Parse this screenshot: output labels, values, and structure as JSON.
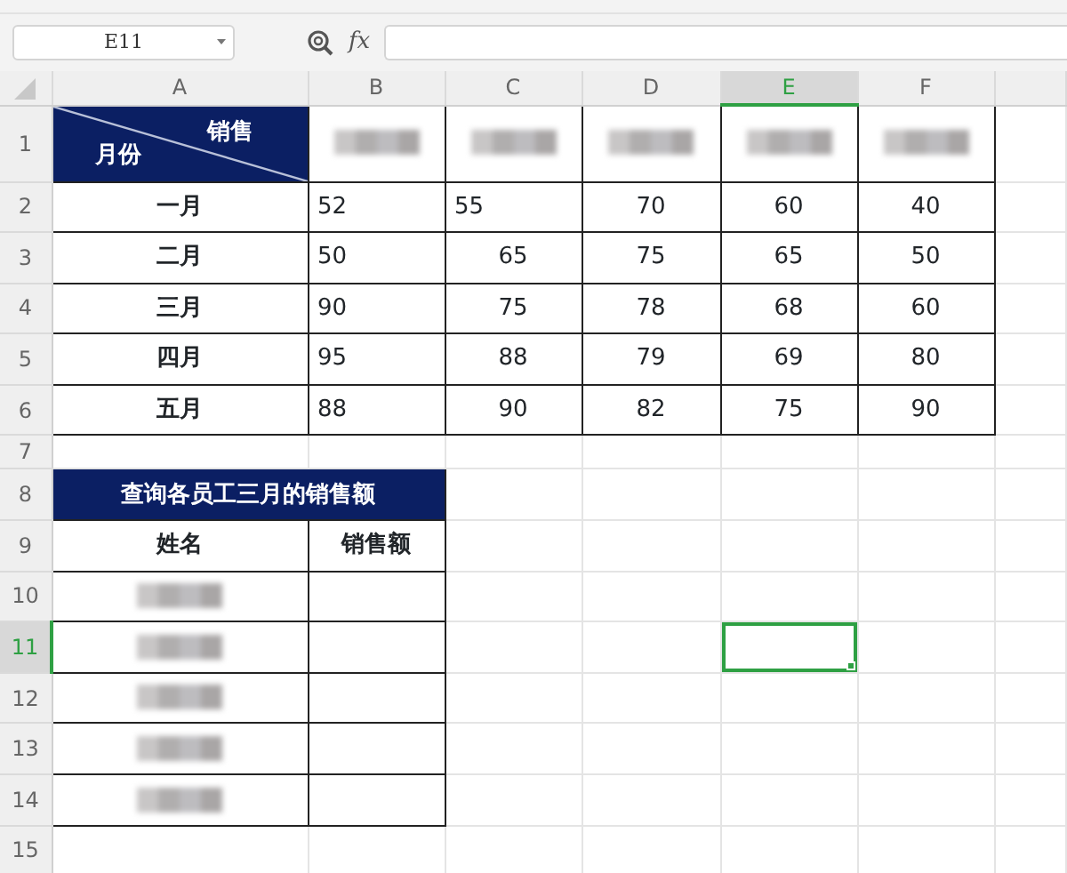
{
  "name_box": {
    "value": "E11"
  },
  "formula_bar": {
    "fx": "fx"
  },
  "columns": [
    {
      "label": "A",
      "selected": false
    },
    {
      "label": "B",
      "selected": false
    },
    {
      "label": "C",
      "selected": false
    },
    {
      "label": "D",
      "selected": false
    },
    {
      "label": "E",
      "selected": true
    },
    {
      "label": "F",
      "selected": false
    }
  ],
  "rows": [
    {
      "number": "1",
      "selected": false,
      "cells": [
        {
          "kind": "diagonal",
          "top_right": "销售",
          "bottom_left": "月份",
          "selected": false
        },
        {
          "kind": "redacted",
          "selected": false
        },
        {
          "kind": "redacted",
          "selected": false
        },
        {
          "kind": "redacted",
          "selected": false
        },
        {
          "kind": "redacted",
          "selected": false
        },
        {
          "kind": "redacted",
          "selected": false
        }
      ]
    },
    {
      "number": "2",
      "selected": false,
      "cells": [
        {
          "kind": "bold",
          "text": "一月",
          "selected": false
        },
        {
          "kind": "left",
          "text": "52",
          "selected": false
        },
        {
          "kind": "left",
          "text": "55",
          "selected": false
        },
        {
          "kind": "plain",
          "text": "70",
          "selected": false
        },
        {
          "kind": "plain",
          "text": "60",
          "selected": false
        },
        {
          "kind": "plain",
          "text": "40",
          "selected": false
        }
      ]
    },
    {
      "number": "3",
      "selected": false,
      "cells": [
        {
          "kind": "bold",
          "text": "二月",
          "selected": false
        },
        {
          "kind": "left",
          "text": "50",
          "selected": false
        },
        {
          "kind": "plain",
          "text": "65",
          "selected": false
        },
        {
          "kind": "plain",
          "text": "75",
          "selected": false
        },
        {
          "kind": "plain",
          "text": "65",
          "selected": false
        },
        {
          "kind": "plain",
          "text": "50",
          "selected": false
        }
      ]
    },
    {
      "number": "4",
      "selected": false,
      "cells": [
        {
          "kind": "bold",
          "text": "三月",
          "selected": false
        },
        {
          "kind": "left",
          "text": "90",
          "selected": false
        },
        {
          "kind": "plain",
          "text": "75",
          "selected": false
        },
        {
          "kind": "plain",
          "text": "78",
          "selected": false
        },
        {
          "kind": "plain",
          "text": "68",
          "selected": false
        },
        {
          "kind": "plain",
          "text": "60",
          "selected": false
        }
      ]
    },
    {
      "number": "5",
      "selected": false,
      "cells": [
        {
          "kind": "bold",
          "text": "四月",
          "selected": false
        },
        {
          "kind": "left",
          "text": "95",
          "selected": false
        },
        {
          "kind": "plain",
          "text": "88",
          "selected": false
        },
        {
          "kind": "plain",
          "text": "79",
          "selected": false
        },
        {
          "kind": "plain",
          "text": "69",
          "selected": false
        },
        {
          "kind": "plain",
          "text": "80",
          "selected": false
        }
      ]
    },
    {
      "number": "6",
      "selected": false,
      "cells": [
        {
          "kind": "bold",
          "text": "五月",
          "selected": false
        },
        {
          "kind": "left",
          "text": "88",
          "selected": false
        },
        {
          "kind": "plain",
          "text": "90",
          "selected": false
        },
        {
          "kind": "plain",
          "text": "82",
          "selected": false
        },
        {
          "kind": "plain",
          "text": "75",
          "selected": false
        },
        {
          "kind": "plain",
          "text": "90",
          "selected": false
        }
      ]
    },
    {
      "number": "7",
      "selected": false,
      "cells": [
        {
          "kind": "empty",
          "selected": false
        },
        {
          "kind": "empty",
          "selected": false
        },
        {
          "kind": "empty",
          "selected": false
        },
        {
          "kind": "empty",
          "selected": false
        },
        {
          "kind": "empty",
          "selected": false
        },
        {
          "kind": "empty",
          "selected": false
        }
      ]
    },
    {
      "number": "8",
      "selected": false,
      "cells": [
        {
          "kind": "title",
          "text": "查询各员工三月的销售额",
          "merged": true,
          "selected": false
        },
        {
          "kind": "empty",
          "selected": false
        },
        {
          "kind": "empty",
          "selected": false
        },
        {
          "kind": "empty",
          "selected": false
        },
        {
          "kind": "empty",
          "selected": false
        }
      ]
    },
    {
      "number": "9",
      "selected": false,
      "cells": [
        {
          "kind": "bold",
          "text": "姓名",
          "selected": false
        },
        {
          "kind": "bold",
          "text": "销售额",
          "selected": false
        },
        {
          "kind": "empty",
          "selected": false
        },
        {
          "kind": "empty",
          "selected": false
        },
        {
          "kind": "empty",
          "selected": false
        },
        {
          "kind": "empty",
          "selected": false
        }
      ]
    },
    {
      "number": "10",
      "selected": false,
      "cells": [
        {
          "kind": "redacted",
          "selected": false
        },
        {
          "kind": "blank",
          "selected": false
        },
        {
          "kind": "empty",
          "selected": false
        },
        {
          "kind": "empty",
          "selected": false
        },
        {
          "kind": "empty",
          "selected": false
        },
        {
          "kind": "empty",
          "selected": false
        }
      ]
    },
    {
      "number": "11",
      "selected": true,
      "cells": [
        {
          "kind": "redacted",
          "selected": false
        },
        {
          "kind": "blank",
          "selected": false
        },
        {
          "kind": "empty",
          "selected": false
        },
        {
          "kind": "empty",
          "selected": false
        },
        {
          "kind": "empty",
          "selected": true
        },
        {
          "kind": "empty",
          "selected": false
        }
      ]
    },
    {
      "number": "12",
      "selected": false,
      "cells": [
        {
          "kind": "redacted",
          "selected": false
        },
        {
          "kind": "blank",
          "selected": false
        },
        {
          "kind": "empty",
          "selected": false
        },
        {
          "kind": "empty",
          "selected": false
        },
        {
          "kind": "empty",
          "selected": false
        },
        {
          "kind": "empty",
          "selected": false
        }
      ]
    },
    {
      "number": "13",
      "selected": false,
      "cells": [
        {
          "kind": "redacted",
          "selected": false
        },
        {
          "kind": "blank",
          "selected": false
        },
        {
          "kind": "empty",
          "selected": false
        },
        {
          "kind": "empty",
          "selected": false
        },
        {
          "kind": "empty",
          "selected": false
        },
        {
          "kind": "empty",
          "selected": false
        }
      ]
    },
    {
      "number": "14",
      "selected": false,
      "cells": [
        {
          "kind": "redacted",
          "selected": false
        },
        {
          "kind": "blank",
          "selected": false
        },
        {
          "kind": "empty",
          "selected": false
        },
        {
          "kind": "empty",
          "selected": false
        },
        {
          "kind": "empty",
          "selected": false
        },
        {
          "kind": "empty",
          "selected": false
        }
      ]
    },
    {
      "number": "15",
      "selected": false,
      "cells": [
        {
          "kind": "empty",
          "selected": false
        },
        {
          "kind": "empty",
          "selected": false
        },
        {
          "kind": "empty",
          "selected": false
        },
        {
          "kind": "empty",
          "selected": false
        },
        {
          "kind": "empty",
          "selected": false
        },
        {
          "kind": "empty",
          "selected": false
        }
      ]
    }
  ]
}
